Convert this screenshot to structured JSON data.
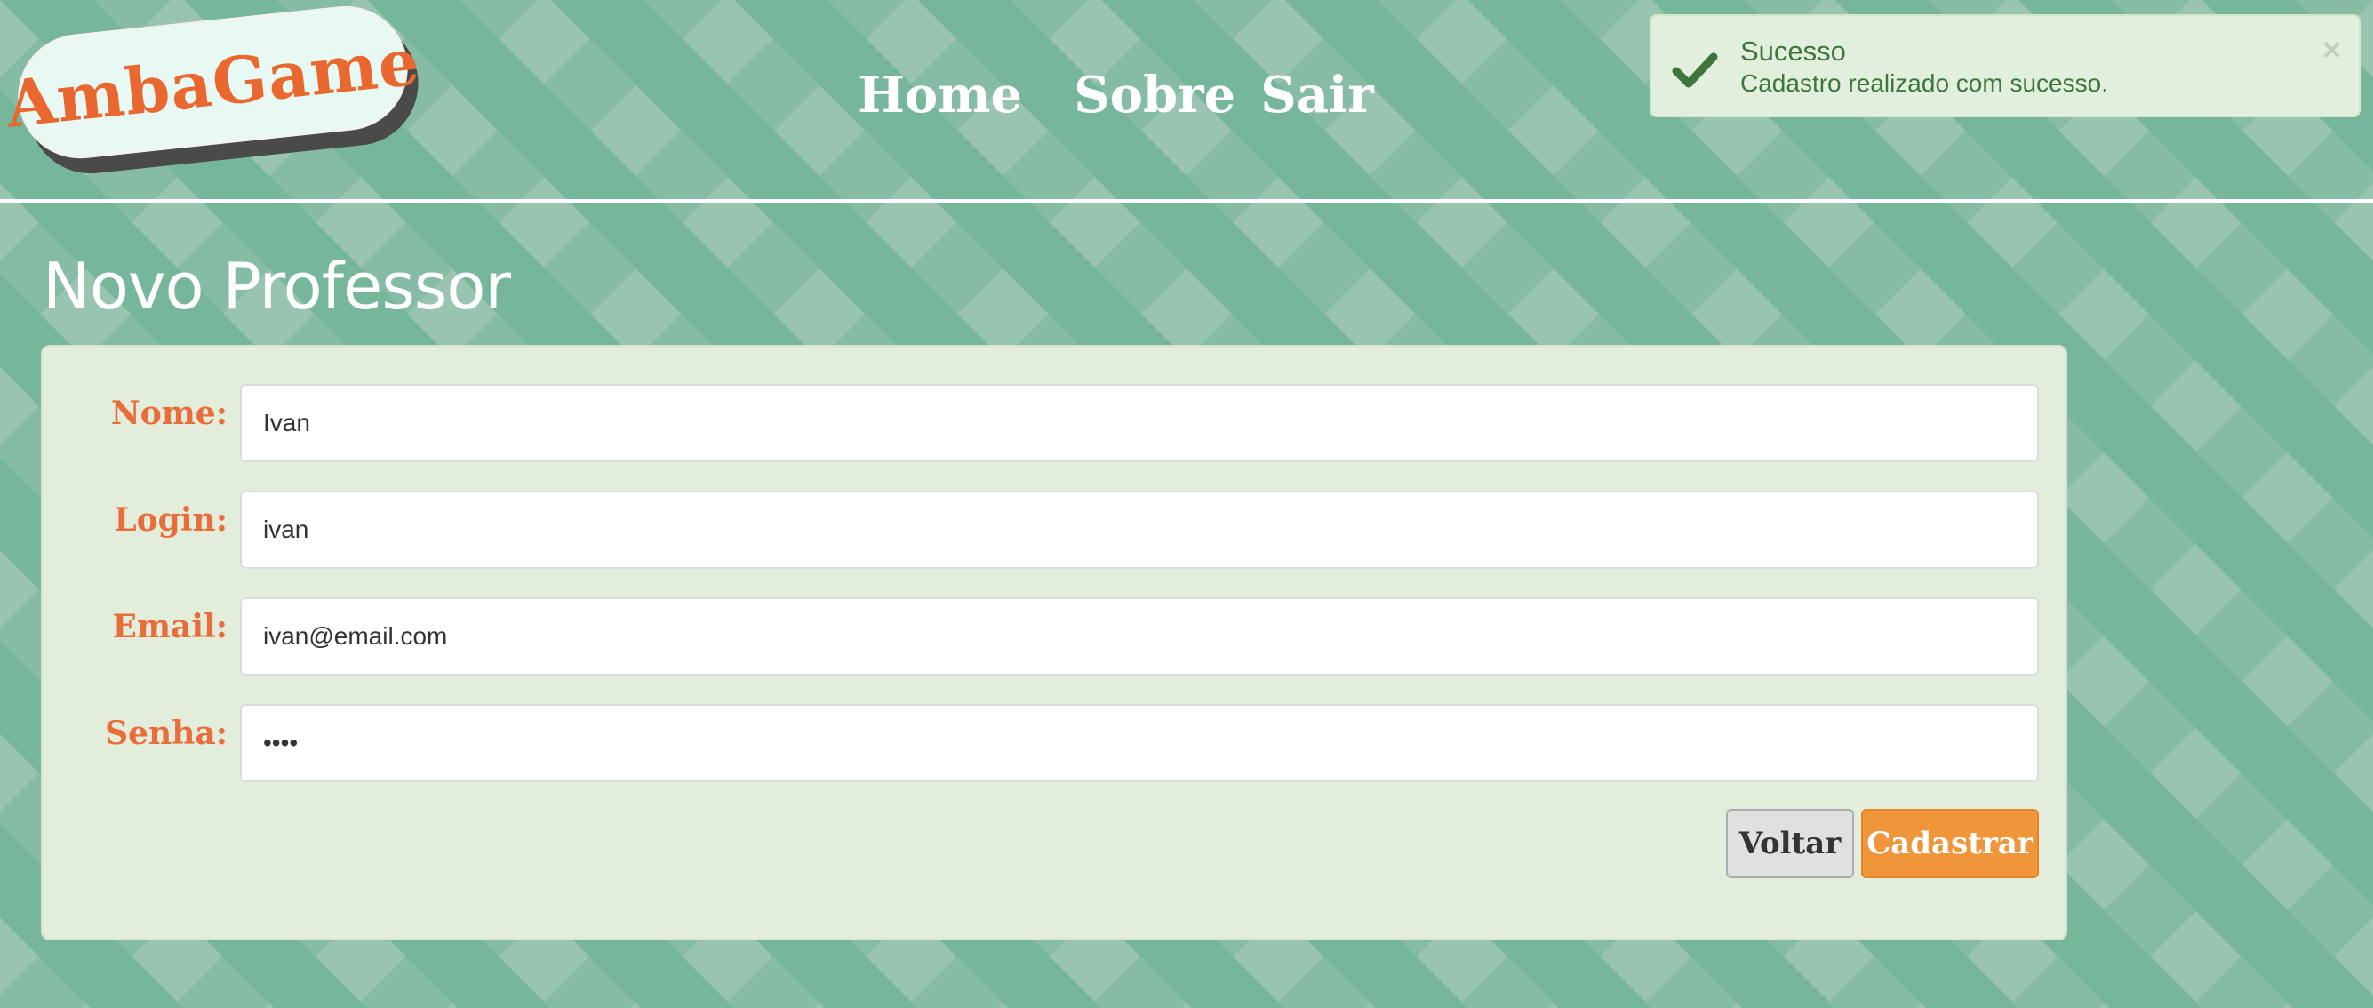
{
  "logo": {
    "text": "AmbaGame"
  },
  "nav": {
    "home": "Home",
    "sobre": "Sobre",
    "sair": "Sair"
  },
  "toast": {
    "title": "Sucesso",
    "message": "Cadastro realizado com sucesso.",
    "close": "×",
    "icon": "check-icon"
  },
  "page": {
    "title": "Novo Professor"
  },
  "form": {
    "nome": {
      "label": "Nome:",
      "value": "Ivan"
    },
    "login": {
      "label": "Login:",
      "value": "ivan"
    },
    "email": {
      "label": "Email:",
      "value": "ivan@email.com"
    },
    "senha": {
      "label": "Senha:",
      "value": "••••"
    }
  },
  "buttons": {
    "voltar": "Voltar",
    "cadastrar": "Cadastrar"
  },
  "colors": {
    "accent": "#e86d3a",
    "primary_button": "#f0963a",
    "success_text": "#3c763d",
    "panel": "#e2eedb",
    "background_dark": "#76b59a",
    "background_light": "#96c3ae"
  }
}
